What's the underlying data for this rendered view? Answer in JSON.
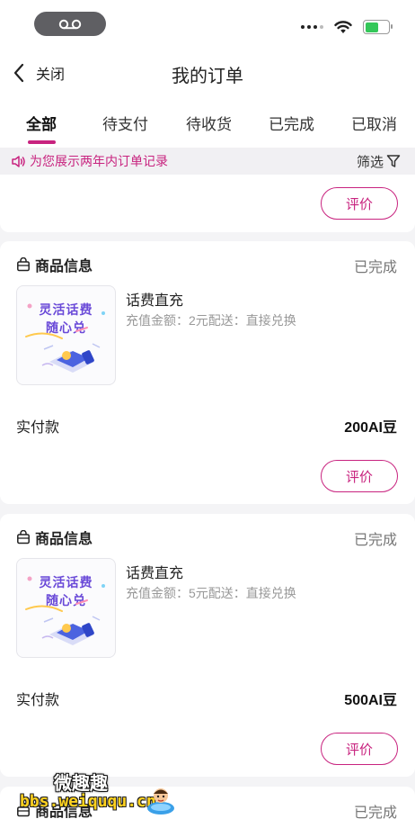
{
  "nav": {
    "back_label": "关闭",
    "title": "我的订单"
  },
  "tabs": [
    {
      "label": "全部",
      "active": true
    },
    {
      "label": "待支付"
    },
    {
      "label": "待收货"
    },
    {
      "label": "已完成"
    },
    {
      "label": "已取消"
    }
  ],
  "notice": {
    "text": "为您展示两年内订单记录",
    "filter_label": "筛选"
  },
  "top_partial_card": {
    "rate_label": "评价"
  },
  "orders": [
    {
      "section_title": "商品信息",
      "status": "已完成",
      "thumb_line1": "灵活话费",
      "thumb_line2": "随心兑",
      "product_name": "话费直充",
      "product_desc": "充值金额：2元配送：直接兑换",
      "paid_label": "实付款",
      "paid_value": "200AI豆",
      "rate_label": "评价"
    },
    {
      "section_title": "商品信息",
      "status": "已完成",
      "thumb_line1": "灵活话费",
      "thumb_line2": "随心兑",
      "product_name": "话费直充",
      "product_desc": "充值金额：5元配送：直接兑换",
      "paid_label": "实付款",
      "paid_value": "500AI豆",
      "rate_label": "评价"
    }
  ],
  "bottom_partial_card": {
    "section_title": "商品信息",
    "status": "已完成"
  },
  "watermark": {
    "line1": "微趣趣",
    "line2": "bbs.weiququ.cn"
  },
  "colors": {
    "accent": "#c8237f",
    "muted": "#999999",
    "background": "#f4f4f6"
  },
  "icons": [
    "voicemail-icon",
    "signal-icon",
    "wifi-icon",
    "battery-icon",
    "back-chevron-icon",
    "speaker-icon",
    "filter-icon",
    "bag-icon"
  ]
}
